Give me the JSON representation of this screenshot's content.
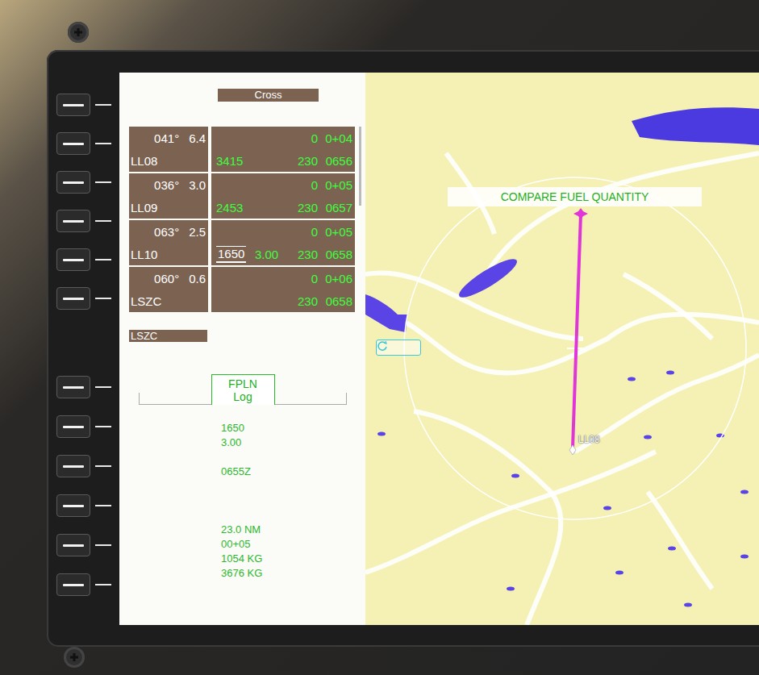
{
  "title": "Cross",
  "legs": [
    {
      "course": "041°",
      "distance": "6.4",
      "waypoint": "LL08",
      "fuel": "0",
      "ete": "0+04",
      "altitude": "3415",
      "fpa": "",
      "speed": "230",
      "eta": "0656",
      "altitude_constrained": false
    },
    {
      "course": "036°",
      "distance": "3.0",
      "waypoint": "LL09",
      "fuel": "0",
      "ete": "0+05",
      "altitude": "2453",
      "fpa": "",
      "speed": "230",
      "eta": "0657",
      "altitude_constrained": false
    },
    {
      "course": "063°",
      "distance": "2.5",
      "waypoint": "LL10",
      "fuel": "0",
      "ete": "0+05",
      "altitude": "1650",
      "fpa": "3.00",
      "speed": "230",
      "eta": "0658",
      "altitude_constrained": true
    },
    {
      "course": "060°",
      "distance": "0.6",
      "waypoint": "LSZC",
      "fuel": "0",
      "ete": "0+06",
      "altitude": "",
      "fpa": "",
      "speed": "230",
      "eta": "0658",
      "altitude_constrained": false
    }
  ],
  "destination": "LSZC",
  "page_tab": {
    "line1": "FPLN",
    "line2": "Log",
    "selected": true
  },
  "log_groups": [
    [
      "1650",
      "3.00"
    ],
    [
      "0655Z"
    ],
    [
      "23.0 NM",
      "00+05",
      "1054 KG",
      "3676 KG"
    ]
  ],
  "map": {
    "message": "COMPARE FUEL QUANTITY",
    "waypoint_label": "LL08"
  }
}
